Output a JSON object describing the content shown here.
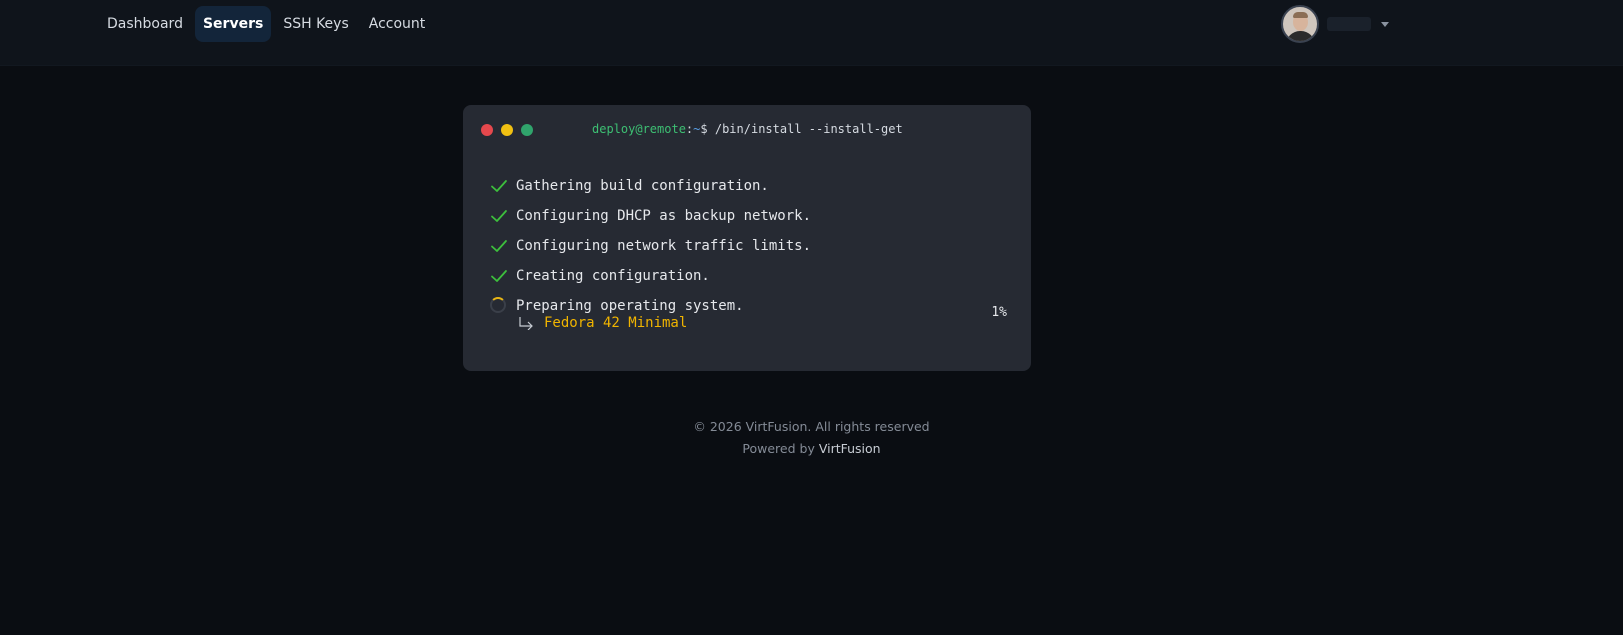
{
  "nav": {
    "links": [
      "Dashboard",
      "Servers",
      "SSH Keys",
      "Account"
    ],
    "active": "Servers"
  },
  "user": {
    "avatar_icon": "user-avatar",
    "caret_icon": "caret-down-icon"
  },
  "terminal": {
    "prompt_user": "deploy@remote",
    "prompt_sep": ":",
    "prompt_path": "~",
    "prompt_symbol": "$",
    "command": "/bin/install --install-get",
    "steps": [
      {
        "status": "done",
        "text": "Gathering build configuration."
      },
      {
        "status": "done",
        "text": "Configuring DHCP as backup network."
      },
      {
        "status": "done",
        "text": "Configuring network traffic limits."
      },
      {
        "status": "done",
        "text": "Creating configuration."
      },
      {
        "status": "in-progress",
        "text": "Preparing operating system."
      }
    ],
    "sub_item": "Fedora 42 Minimal",
    "progress": "1%",
    "colors": {
      "done": "#3dbf3d",
      "spinner": "#e8b516",
      "sub_item": "#f0b400"
    }
  },
  "footer": {
    "copyright": "© 2026 VirtFusion. All rights reserved",
    "powered_prefix": "Powered by",
    "powered_brand": "VirtFusion"
  }
}
